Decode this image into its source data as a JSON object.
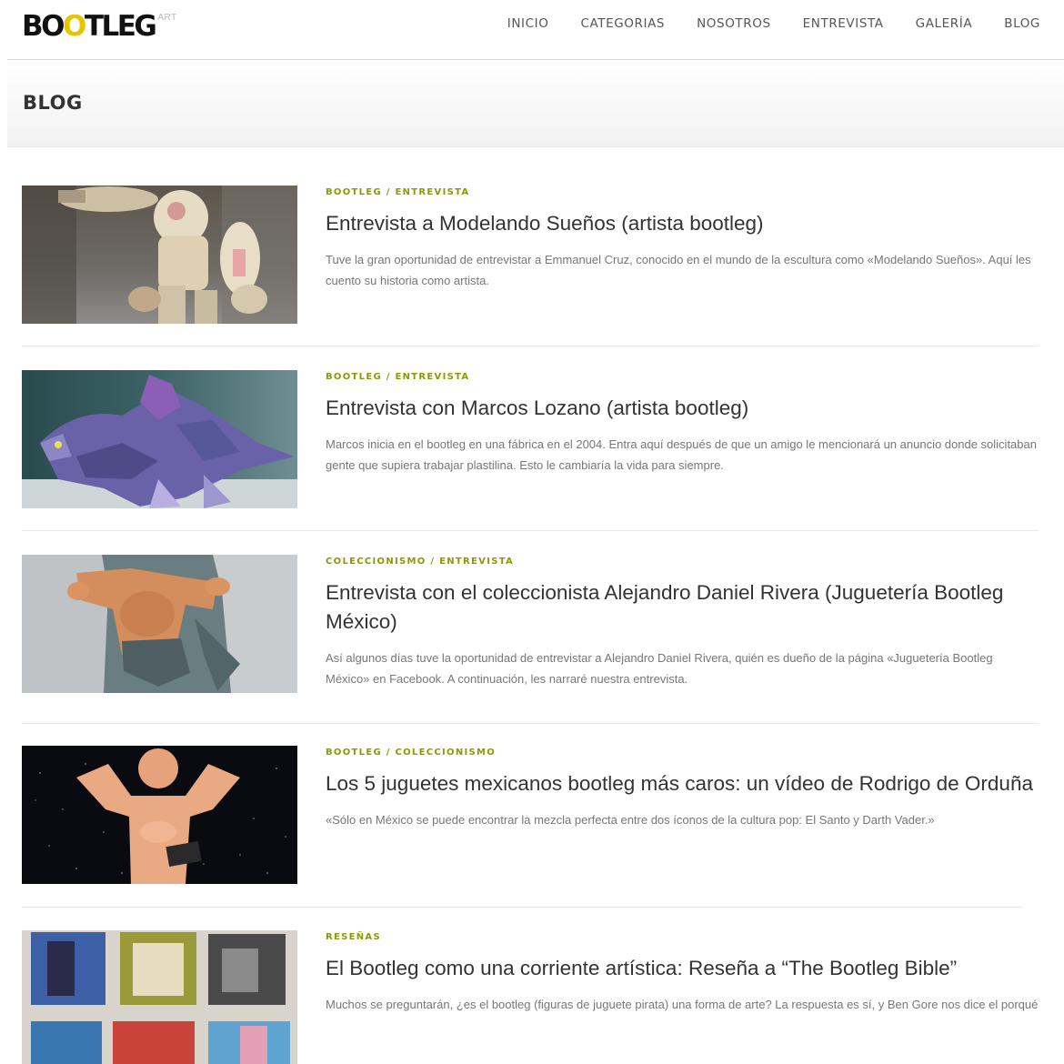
{
  "site": {
    "logo_main_1": "BO",
    "logo_main_o": "O",
    "logo_main_2": "TLEG",
    "logo_sub": "ART"
  },
  "nav": {
    "items": [
      "INICIO",
      "CATEGORIAS",
      "NOSOTROS",
      "ENTREVISTA",
      "GALERÍA",
      "BLOG"
    ]
  },
  "page": {
    "title": "BLOG"
  },
  "posts": [
    {
      "categories": "BOOTLEG / ENTREVISTA",
      "title": "Entrevista a Modelando Sueños (artista bootleg)",
      "excerpt": "Tuve la gran oportunidad de entrevistar a Emmanuel Cruz, conocido en el mundo de la escultura como «Modelando Sueños». Aquí les cuento su historia como artista."
    },
    {
      "categories": "BOOTLEG / ENTREVISTA",
      "title": "Entrevista con Marcos Lozano (artista bootleg)",
      "excerpt": "Marcos inicia en el bootleg en una fábrica en el 2004. Entra aquí después de que un amigo le mencionará un anuncio donde solicitaban gente que supiera trabajar plastilina. Esto le cambiaría la vida para siempre."
    },
    {
      "categories": "COLECCIONISMO / ENTREVISTA",
      "title": "Entrevista con el coleccionista Alejandro Daniel Rivera (Juguetería Bootleg México)",
      "excerpt": "Así algunos días tuve la oportunidad de entrevistar a Alejandro Daniel Rivera, quién es dueño de la página «Juguetería Bootleg México» en Facebook. A continuación, les narraré nuestra entrevista."
    },
    {
      "categories": "BOOTLEG / COLECCIONISMO",
      "title": "Los 5 juguetes mexicanos bootleg más caros: un vídeo de Rodrigo de Orduña",
      "excerpt": "«Sólo en México se puede encontrar la mezcla perfecta entre dos íconos de la cultura pop: El Santo y Darth Vader.»"
    },
    {
      "categories": "RESEÑAS",
      "title": "El Bootleg como una corriente artística: Reseña a “The Bootleg Bible”",
      "excerpt": "Muchos se preguntarán, ¿es el bootleg (figuras de juguete pirata) una forma de arte? La respuesta es sí, y Ben Gore nos dice el porqué"
    }
  ],
  "colors": {
    "accent_category": "#8a9a00",
    "logo_yellow": "#e8c500"
  }
}
